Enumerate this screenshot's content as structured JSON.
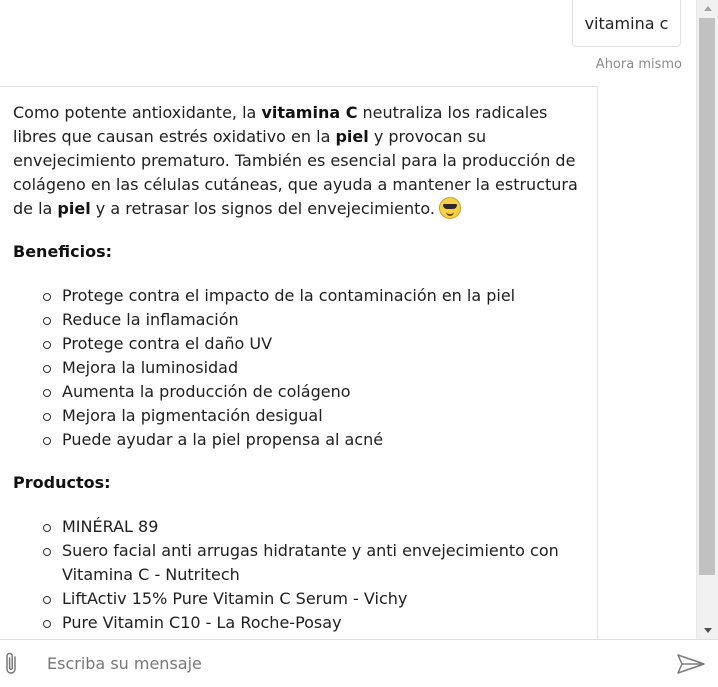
{
  "user_message": {
    "text": "vitamina c",
    "timestamp": "Ahora mismo"
  },
  "bot_message": {
    "intro": [
      {
        "t": "Como potente antioxidante, la ",
        "b": false
      },
      {
        "t": "vitamina C",
        "b": true
      },
      {
        "t": " neutraliza los radicales libres que causan estrés oxidativo en la ",
        "b": false
      },
      {
        "t": "piel",
        "b": true
      },
      {
        "t": " y provocan su envejecimiento prematuro. También es esencial para la producción de colágeno en las células cutáneas, que ayuda a mantener la estructura de la ",
        "b": false
      },
      {
        "t": "piel",
        "b": true
      },
      {
        "t": " y a retrasar los signos del envejecimiento.",
        "b": false
      }
    ],
    "emoji": "smiling-face-with-sunglasses",
    "benefits_title": "Beneficios:",
    "benefits": [
      "Protege contra el impacto de la contaminación en la piel",
      "Reduce la inflamación",
      "Protege contra el daño UV",
      "Mejora la luminosidad",
      "Aumenta la producción de colágeno",
      "Mejora la pigmentación desigual",
      "Puede ayudar a la piel propensa al acné"
    ],
    "products_title": "Productos:",
    "products": [
      "MINÉRAL 89",
      "Suero facial anti arrugas hidratante y anti envejecimiento con Vitamina C - Nutritech",
      "LiftActiv 15% Pure Vitamin C Serum - Vichy",
      "Pure Vitamin C10 - La Roche-Posay"
    ]
  },
  "composer": {
    "placeholder": "Escriba su mensaje",
    "value": "",
    "attach_icon": "paperclip-icon",
    "send_icon": "send-icon"
  },
  "colors": {
    "accent": "#c1c1c1",
    "text": "#202020",
    "muted": "#8a8a8a"
  }
}
